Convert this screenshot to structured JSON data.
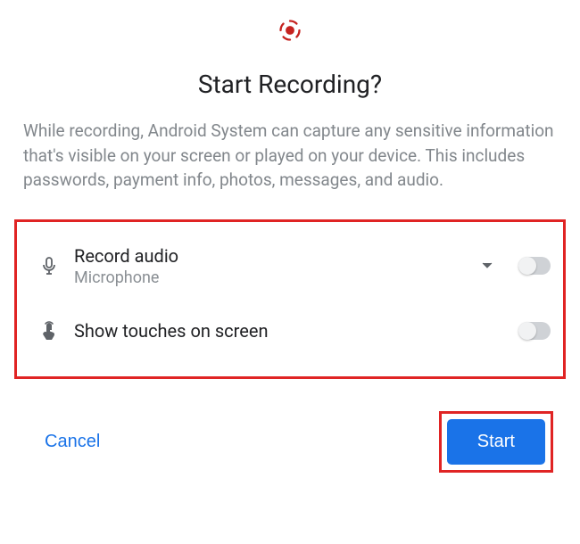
{
  "dialog": {
    "title": "Start Recording?",
    "body": "While recording, Android System can capture any sensitive information that's visible on your screen or played on your device. This includes passwords, payment info, photos, messages, and audio."
  },
  "options": {
    "audio": {
      "title": "Record audio",
      "subtitle": "Microphone",
      "enabled": false
    },
    "touches": {
      "title": "Show touches on screen",
      "enabled": false
    }
  },
  "buttons": {
    "cancel": "Cancel",
    "start": "Start"
  },
  "colors": {
    "accent": "#1a73e8",
    "highlight": "#e02424",
    "record_icon": "#c5221f"
  },
  "icons": {
    "record": "record-target-icon",
    "mic": "microphone-icon",
    "touch": "touch-icon",
    "chevron": "chevron-down-icon"
  }
}
